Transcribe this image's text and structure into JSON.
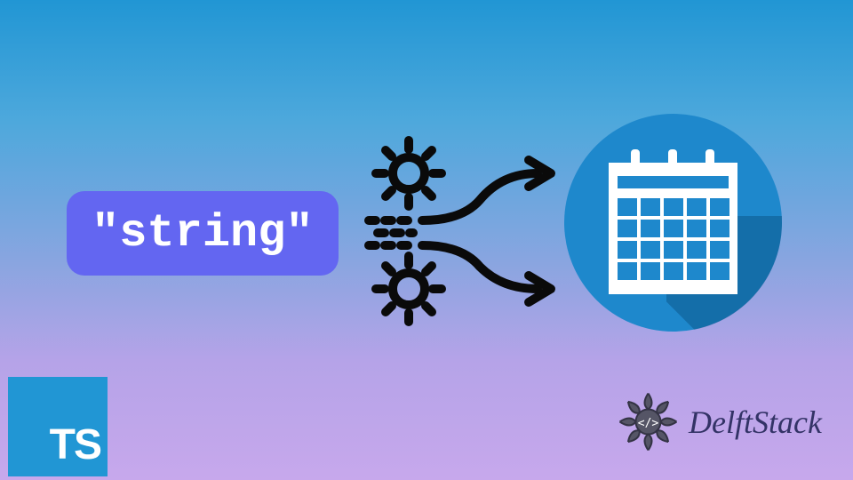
{
  "badge": {
    "text": "\"string\""
  },
  "ts_logo": {
    "label": "TS"
  },
  "brand": {
    "name": "DelftStack"
  },
  "icons": {
    "gears": "gears-transform-icon",
    "calendar": "calendar-icon",
    "mandala": "mandala-icon"
  },
  "colors": {
    "badge_bg": "#6366f1",
    "calendar_circle": "#1e88cc",
    "ts_bg": "#2196d4"
  }
}
